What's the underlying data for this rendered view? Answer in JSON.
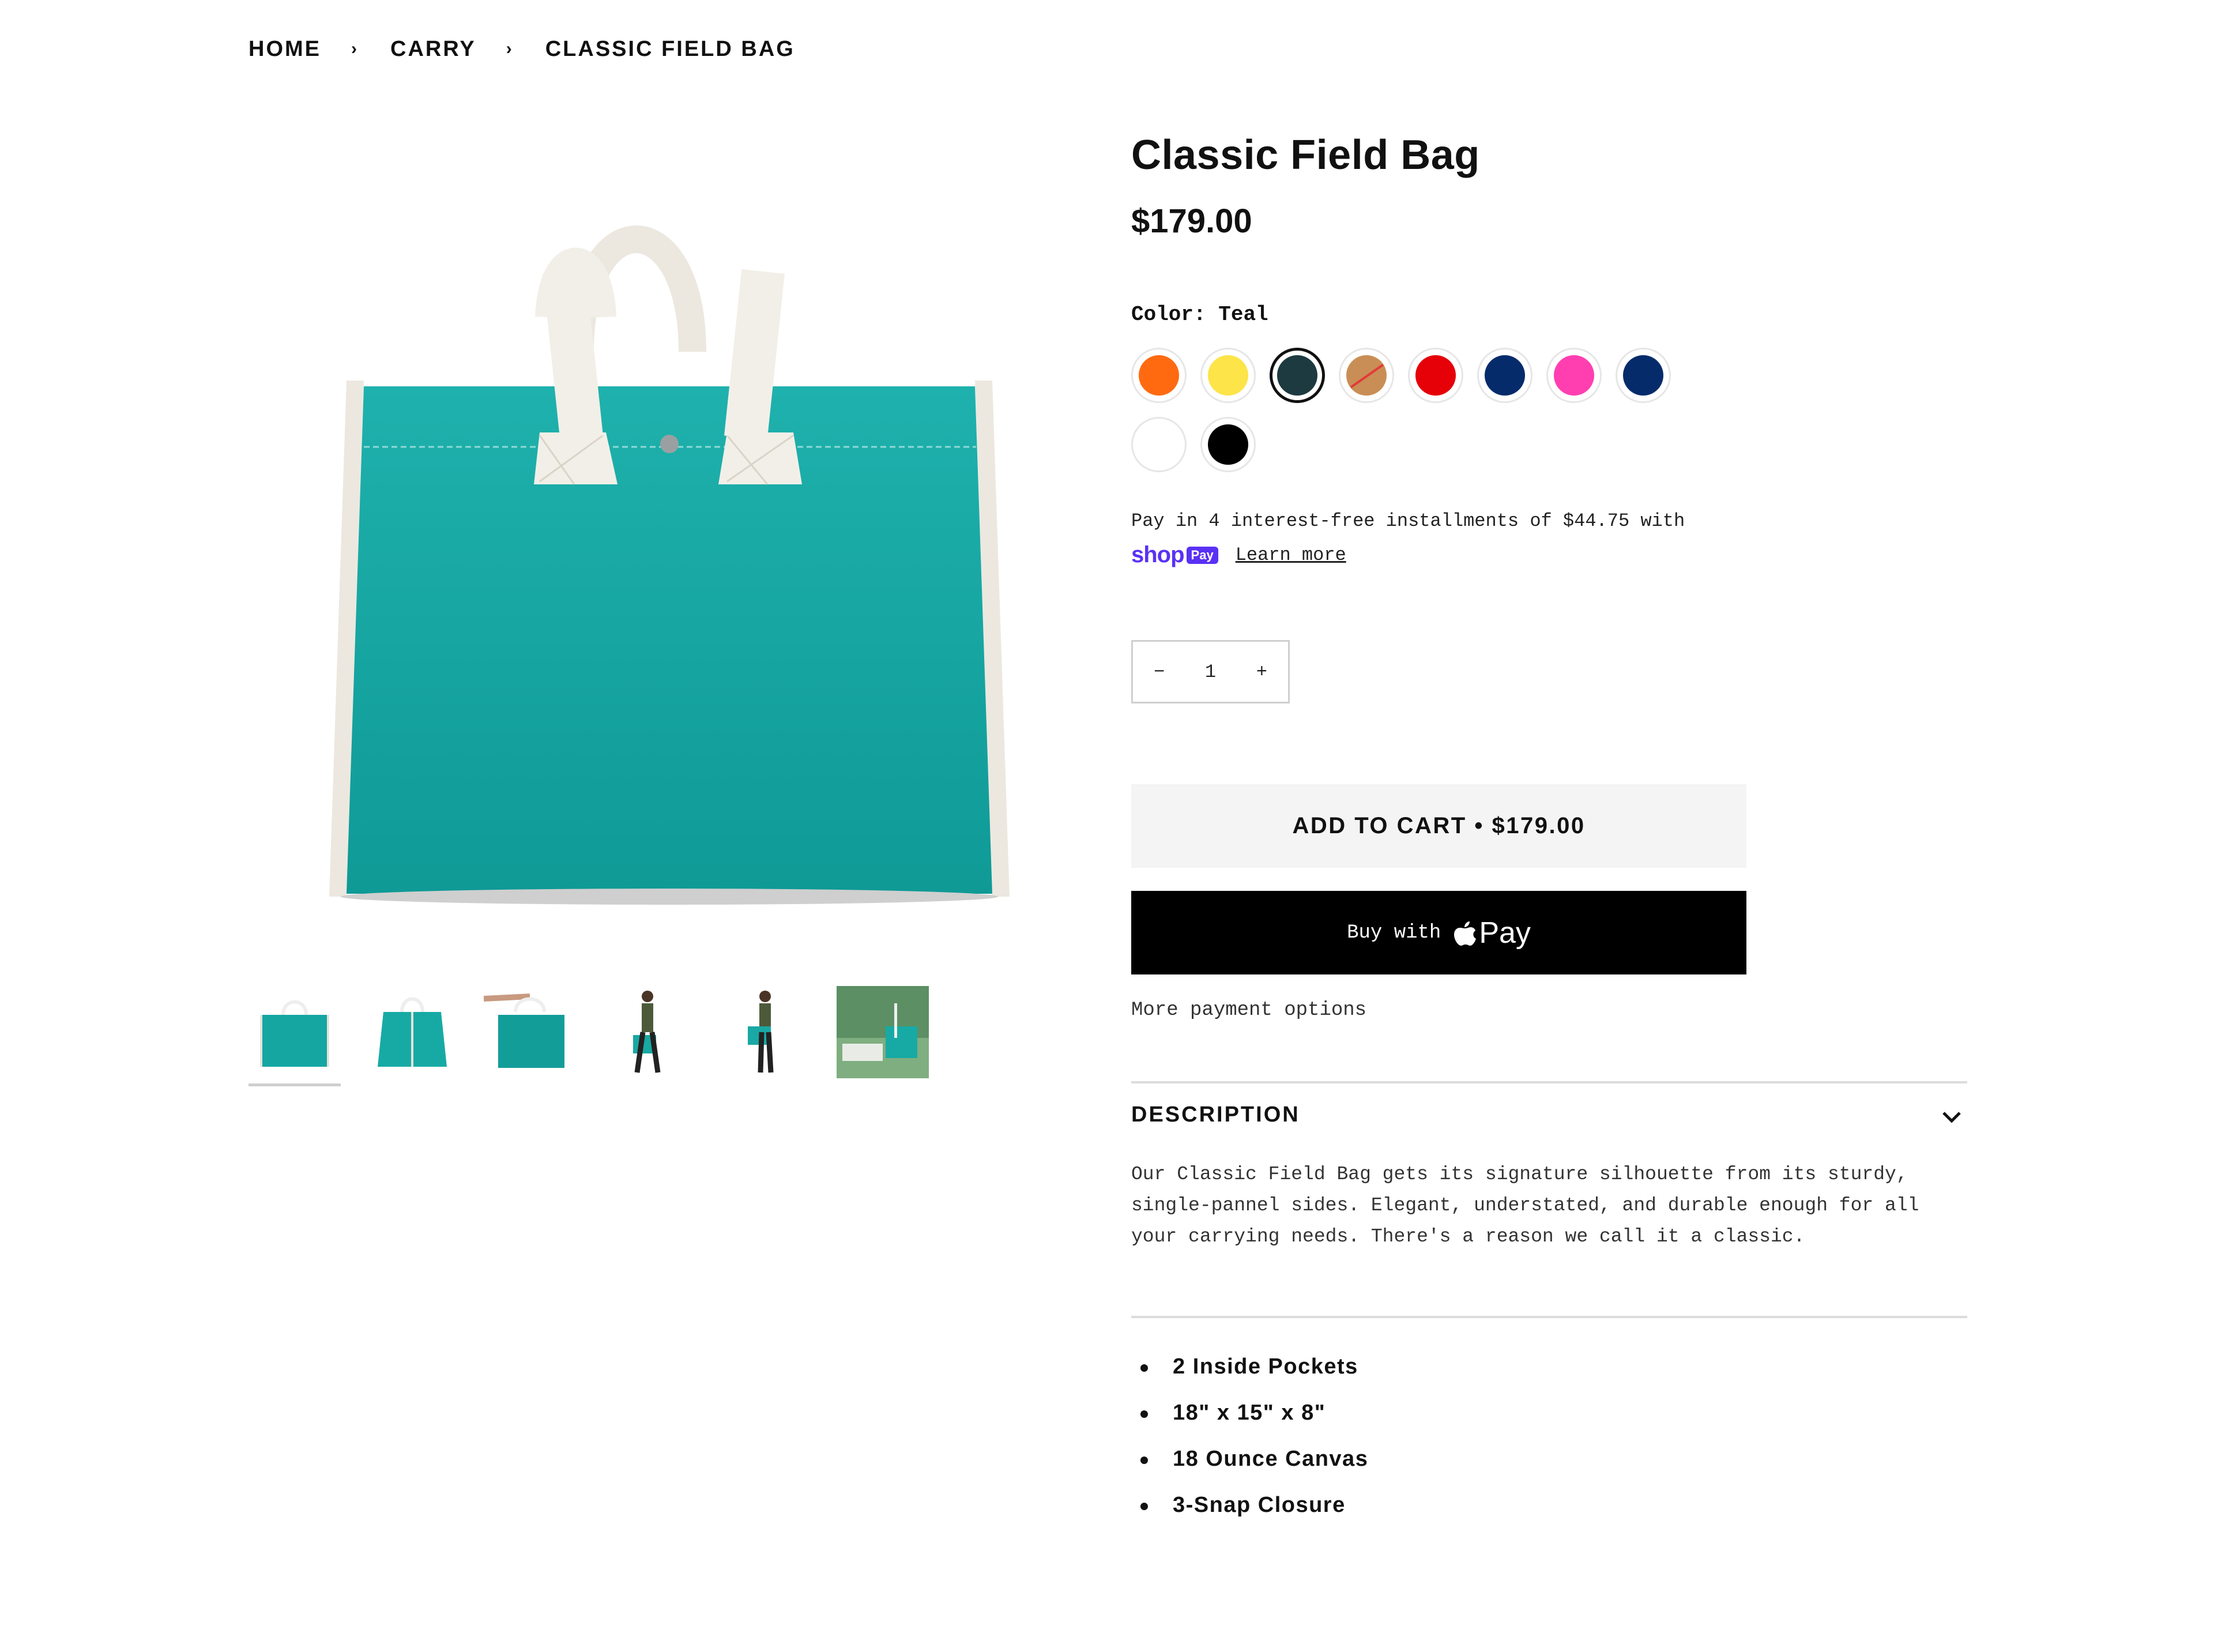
{
  "breadcrumb": {
    "items": [
      "HOME",
      "CARRY",
      "CLASSIC FIELD BAG"
    ],
    "separator": "›"
  },
  "gallery": {
    "main_image": "teal-field-bag",
    "thumbnails": [
      "bag-front",
      "bag-angle",
      "bag-held-hand",
      "model-walking",
      "model-standing",
      "bag-lifestyle"
    ],
    "active_index": 0
  },
  "product": {
    "title": "Classic Field Bag",
    "price": "$179.00",
    "color_label": "Color:",
    "color_value": "Teal",
    "swatches": [
      {
        "name": "Orange",
        "hex": "#ff6a10"
      },
      {
        "name": "Yellow",
        "hex": "#fde449"
      },
      {
        "name": "Teal",
        "hex": "#1d3a40",
        "selected": true
      },
      {
        "name": "Tan",
        "hex": "#c98e55",
        "sold_out": true
      },
      {
        "name": "Red",
        "hex": "#e60008"
      },
      {
        "name": "Navy",
        "hex": "#052b6b"
      },
      {
        "name": "Pink",
        "hex": "#ff3fb0"
      },
      {
        "name": "Navy",
        "hex": "#052b6b"
      },
      {
        "name": "White",
        "hex": "#ffffff"
      },
      {
        "name": "Black",
        "hex": "#000000"
      }
    ]
  },
  "payment": {
    "installments_text": "Pay in 4 interest-free installments of $44.75 with",
    "shop_pay_logo": "shop",
    "shop_pay_badge": "Pay",
    "learn_more": "Learn more"
  },
  "quantity": {
    "minus": "−",
    "value": "1",
    "plus": "+"
  },
  "add_to_cart": "ADD TO CART • $179.00",
  "buy_now": {
    "prefix": "Buy with",
    "brand": "Pay"
  },
  "more_payment_options": "More payment options",
  "description": {
    "heading": "DESCRIPTION",
    "lines": [
      "Our Classic Field Bag gets its signature silhouette from its sturdy,",
      "single-pannel sides. Elegant, understated, and durable enough for all",
      "your carrying needs. There's a reason we call it a classic."
    ],
    "features": [
      "2 Inside Pockets",
      "18\" x 15\" x 8\"",
      "18 Ounce Canvas",
      "3-Snap Closure"
    ]
  },
  "colors": {
    "accent_shoppay": "#5a31f4",
    "button_dark": "#000000",
    "button_light": "#f4f4f4"
  }
}
